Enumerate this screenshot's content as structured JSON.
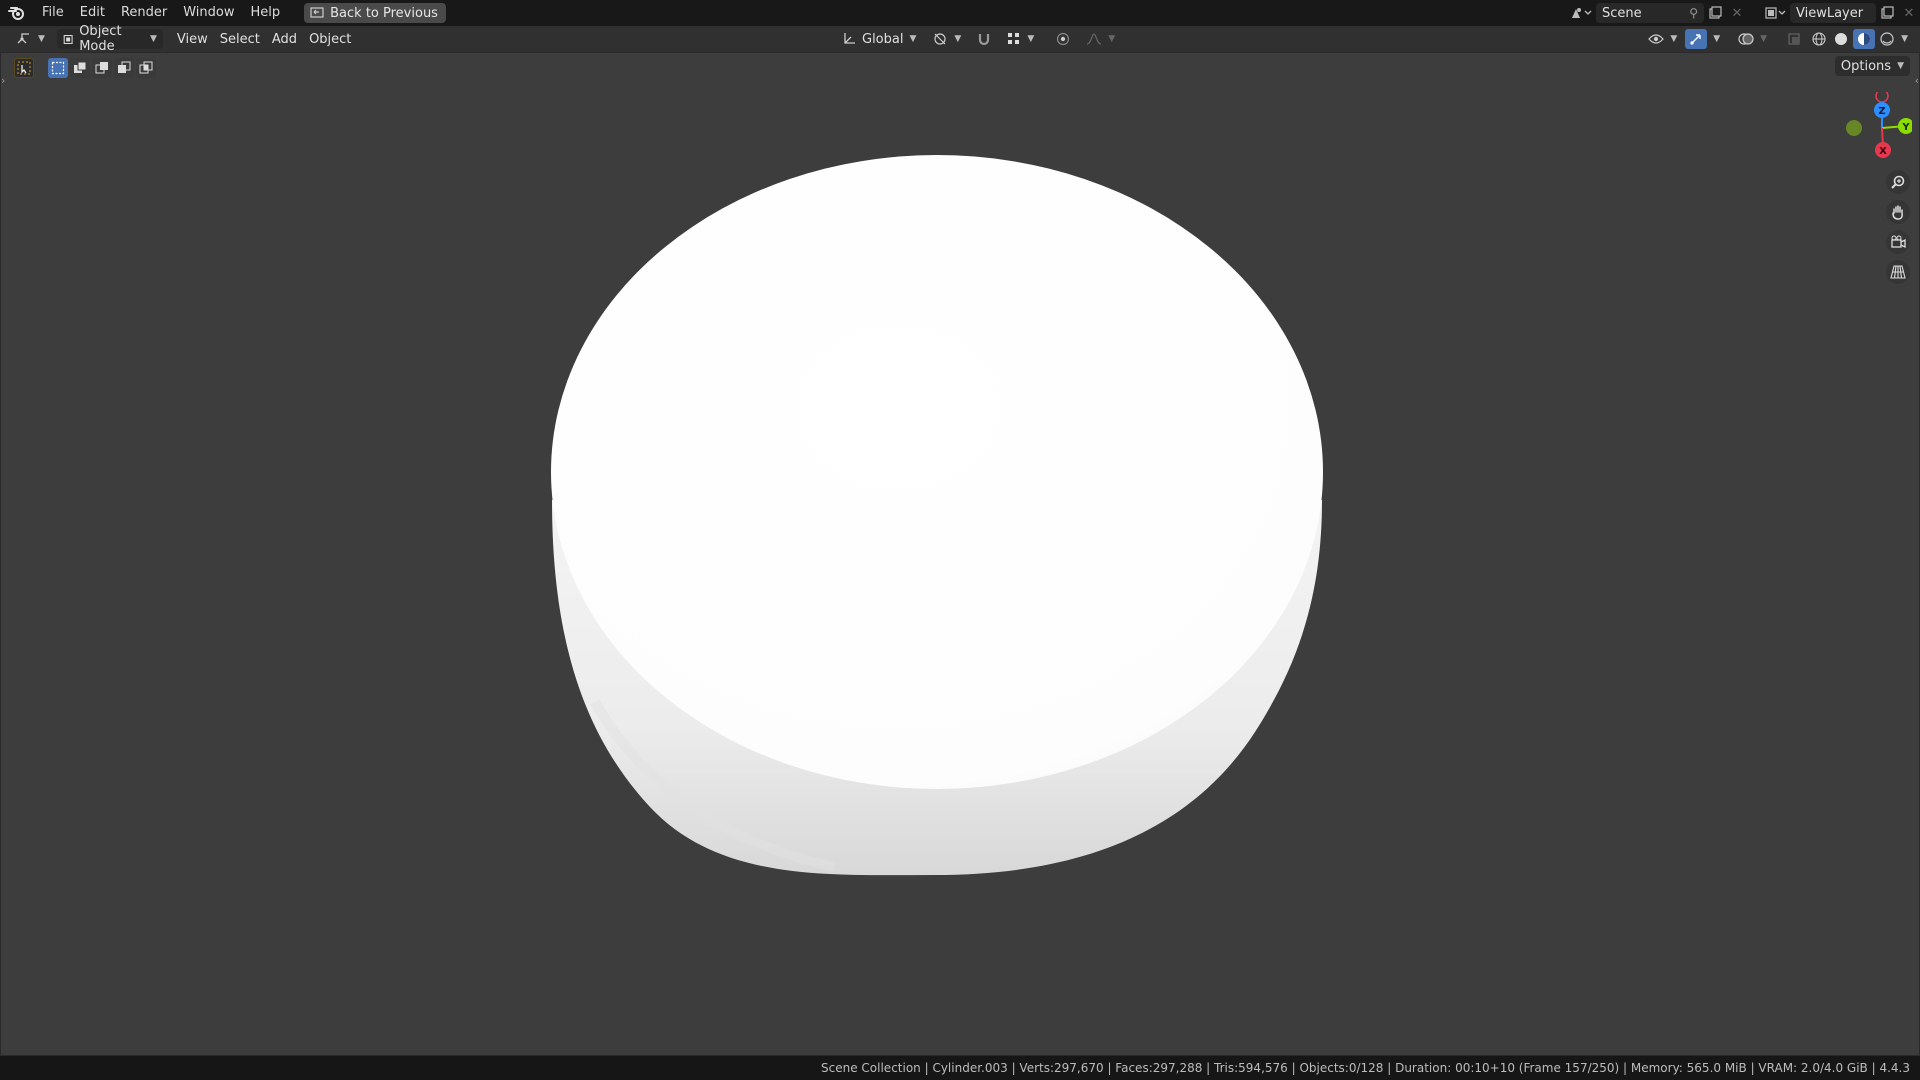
{
  "menubar": {
    "items": [
      "File",
      "Edit",
      "Render",
      "Window",
      "Help"
    ],
    "back_button": "Back to Previous",
    "scene_name": "Scene",
    "view_layer": "ViewLayer"
  },
  "viewport_header": {
    "mode": "Object Mode",
    "menus": [
      "View",
      "Select",
      "Add",
      "Object"
    ],
    "transform_orientation": "Global"
  },
  "viewport": {
    "options_label": "Options",
    "gizmo": {
      "z": "Z",
      "y": "Y",
      "x": "X"
    },
    "object_name": "Cylinder.003"
  },
  "statusbar": {
    "text": "Scene Collection | Cylinder.003 | Verts:297,670 | Faces:297,288 | Tris:594,576 | Objects:0/128 | Duration: 00:10+10 (Frame 157/250) | Memory: 565.0 MiB | VRAM: 2.0/4.0 GiB | 4.4.3"
  },
  "colors": {
    "accent": "#4772b3",
    "axis_x": "#e8384f",
    "axis_y": "#8bdc00",
    "axis_z": "#2c8fff"
  }
}
